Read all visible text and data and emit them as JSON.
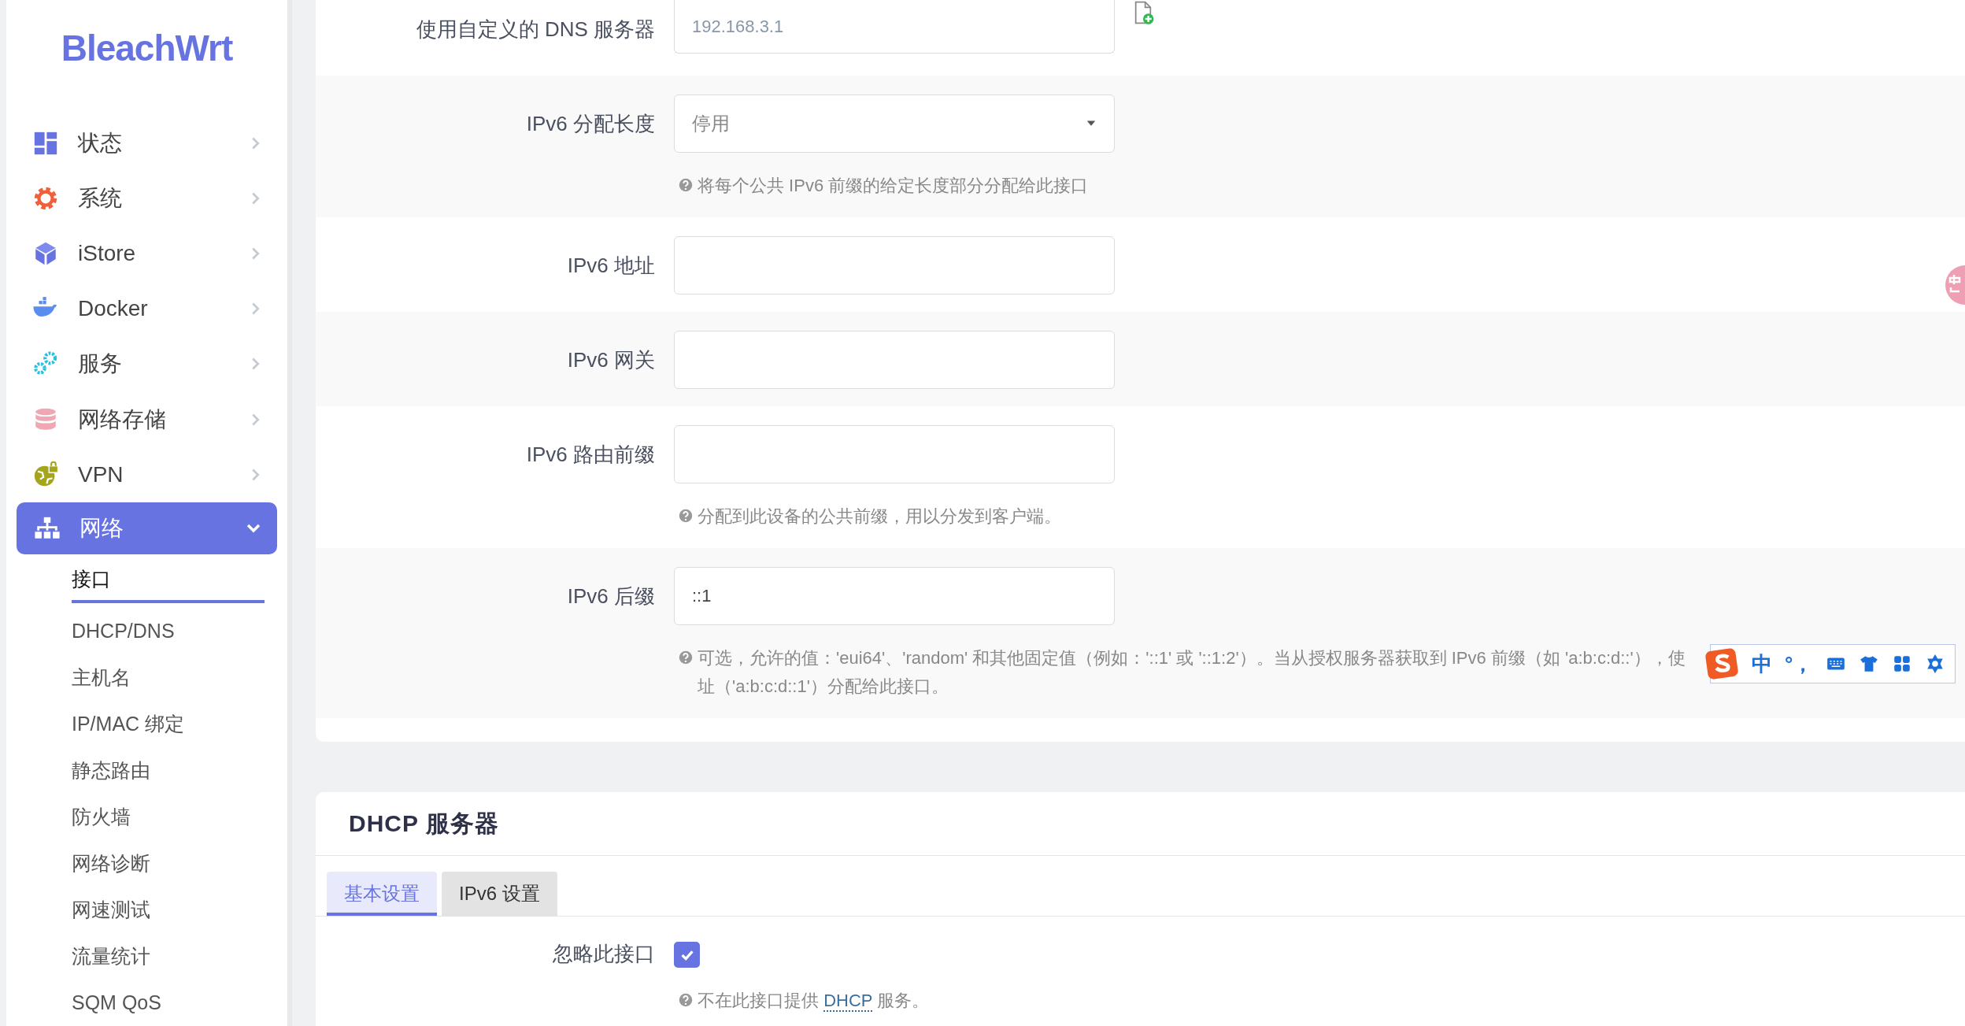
{
  "sidebar": {
    "logo": "BleachWrt",
    "menu": [
      {
        "label": "状态",
        "expanded": false
      },
      {
        "label": "系统",
        "expanded": false
      },
      {
        "label": "iStore",
        "expanded": false
      },
      {
        "label": "Docker",
        "expanded": false
      },
      {
        "label": "服务",
        "expanded": false
      },
      {
        "label": "网络存储",
        "expanded": false
      },
      {
        "label": "VPN",
        "expanded": false
      },
      {
        "label": "网络",
        "expanded": true,
        "children": [
          {
            "label": "接口",
            "selected": true
          },
          {
            "label": "DHCP/DNS",
            "selected": false
          },
          {
            "label": "主机名",
            "selected": false
          },
          {
            "label": "IP/MAC 绑定",
            "selected": false
          },
          {
            "label": "静态路由",
            "selected": false
          },
          {
            "label": "防火墙",
            "selected": false
          },
          {
            "label": "网络诊断",
            "selected": false
          },
          {
            "label": "网速测试",
            "selected": false
          },
          {
            "label": "流量统计",
            "selected": false
          },
          {
            "label": "SQM QoS",
            "selected": false
          }
        ]
      }
    ]
  },
  "interface_form": {
    "fields": [
      {
        "kind": "text",
        "label": "使用自定义的 DNS 服务器",
        "placeholder": "192.168.3.1",
        "add_button": true
      },
      {
        "kind": "select",
        "label": "IPv6 分配长度",
        "value": "停用",
        "hint": [
          "将每个公共 IPv6 前缀的给定长度部分分配给此接口"
        ]
      },
      {
        "kind": "text",
        "label": "IPv6 地址"
      },
      {
        "kind": "text",
        "label": "IPv6 网关"
      },
      {
        "kind": "text",
        "label": "IPv6 路由前缀",
        "hint": [
          "分配到此设备的公共前缀，用以分发到客户端。"
        ]
      },
      {
        "kind": "text",
        "label": "IPv6 后缀",
        "value": "::1",
        "hint": [
          "可选，允许的值：'eui64'、'random' 和其他固定值（例如：'::1' 或 '::1:2'）。当从授权服务器获取到 IPv6 前缀（如 'a:b:c:d::'），使",
          "址（'a:b:c:d::1'）分配给此接口。"
        ]
      }
    ]
  },
  "dhcp_section": {
    "title": "DHCP 服务器",
    "tabs": [
      {
        "label": "基本设置",
        "selected": true
      },
      {
        "label": "IPv6 设置",
        "selected": false
      }
    ],
    "fields": [
      {
        "kind": "checkbox",
        "label": "忽略此接口",
        "checked": true,
        "hint": [
          {
            "text": "不在此接口提供 "
          },
          {
            "text": "DHCP",
            "kind": "abbr"
          },
          {
            "text": " 服务。"
          }
        ]
      }
    ]
  },
  "ime_toolbar": {
    "items": [
      {
        "kind": "logo"
      },
      {
        "kind": "text",
        "text": "中"
      },
      {
        "kind": "text",
        "text": "°，"
      },
      {
        "kind": "keyboard"
      },
      {
        "kind": "shirt"
      },
      {
        "kind": "apps"
      },
      {
        "kind": "settings"
      }
    ]
  }
}
